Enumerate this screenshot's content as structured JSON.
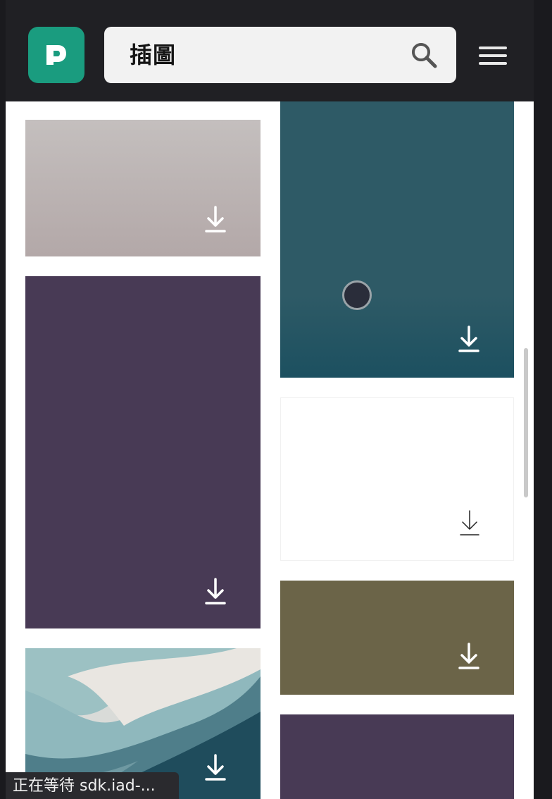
{
  "app": {
    "logo_icon": "pixabay-logo-icon",
    "brand_color": "#1a9c7f"
  },
  "search": {
    "value": "插圖",
    "icon": "search-icon"
  },
  "menu": {
    "icon": "hamburger-menu-icon"
  },
  "gallery": {
    "tiles": [
      {
        "id": "tile-1",
        "color_top": "#c4bfbe",
        "color_bottom": "#b3a8a8",
        "download_icon": "download-icon"
      },
      {
        "id": "tile-2",
        "color": "#483a55",
        "download_icon": "download-icon"
      },
      {
        "id": "tile-3",
        "color_top": "#cfcfcd",
        "color_bottom": "#2c5564",
        "download_icon": "download-icon"
      },
      {
        "id": "tile-4",
        "color": "#2e5a66",
        "download_icon": "download-icon"
      },
      {
        "id": "tile-5",
        "color": "#ffffff",
        "download_icon": "download-icon"
      },
      {
        "id": "tile-6",
        "color": "#6b6448",
        "download_icon": "download-icon"
      },
      {
        "id": "tile-7",
        "color": "#483a55"
      }
    ]
  },
  "status_bar": {
    "text": "正在等待 sdk.iad-..."
  }
}
